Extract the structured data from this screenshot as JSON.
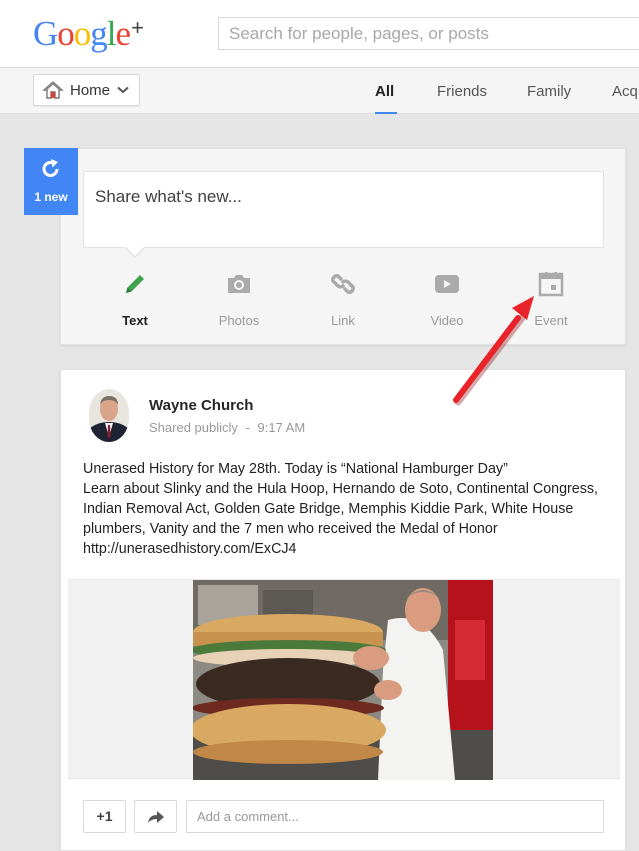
{
  "header": {
    "logo_letters": [
      "G",
      "o",
      "o",
      "g",
      "l",
      "e"
    ],
    "logo_plus": "+",
    "search_placeholder": "Search for people, pages, or posts"
  },
  "nav": {
    "home_label": "Home",
    "tabs": [
      "All",
      "Friends",
      "Family",
      "Acq"
    ],
    "active_tab": "All"
  },
  "share": {
    "new_badge": "1 new",
    "prompt": "Share what's new...",
    "options": [
      {
        "label": "Text",
        "icon": "pencil-icon",
        "selected": true
      },
      {
        "label": "Photos",
        "icon": "camera-icon",
        "selected": false
      },
      {
        "label": "Link",
        "icon": "link-icon",
        "selected": false
      },
      {
        "label": "Video",
        "icon": "video-icon",
        "selected": false
      },
      {
        "label": "Event",
        "icon": "calendar-icon",
        "selected": false
      }
    ]
  },
  "post": {
    "author": "Wayne Church",
    "visibility": "Shared publicly",
    "separator": "-",
    "time": "9:17 AM",
    "lines": [
      "Unerased History for May 28th. Today is “National Hamburger Day”",
      "Learn about Slinky and the Hula Hoop, Hernando de Soto, Continental Congress,",
      "Indian Removal Act, Golden Gate Bridge, Memphis Kiddie Park, White House",
      "plumbers, Vanity and the 7 men who received the Medal of Honor",
      "http://unerasedhistory.com/ExCJ4"
    ],
    "plus_one": "+1",
    "comment_placeholder": "Add a comment..."
  },
  "colors": {
    "accent": "#4285f4",
    "text_selected_icon": "#3fa34d",
    "annotation_arrow": "#e8232a"
  }
}
